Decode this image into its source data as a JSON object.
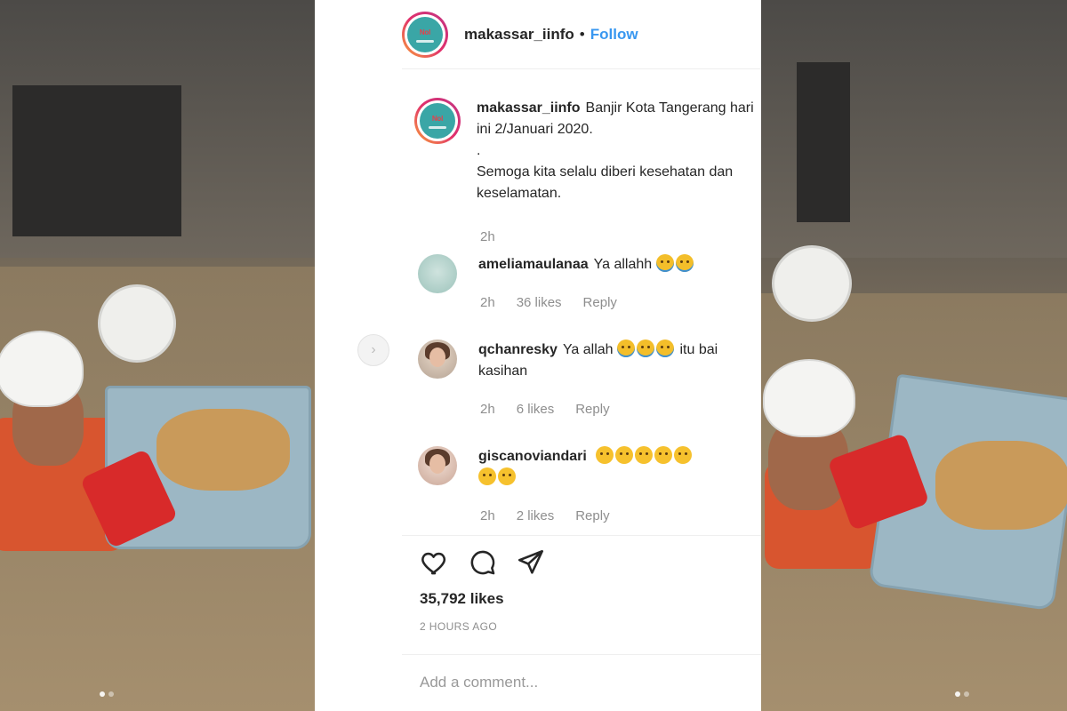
{
  "post": {
    "username": "makassar_iinfo",
    "follow_label": "Follow",
    "separator": "•",
    "logo_text": "Nol"
  },
  "caption": {
    "username": "makassar_iinfo",
    "line1": "Banjir Kota Tangerang hari ini 2/Januari 2020.",
    "line2": ".",
    "line3": "Semoga kita selalu diberi kesehatan dan keselamatan.",
    "time": "2h"
  },
  "comments": [
    {
      "username": "ameliamaulanaa",
      "text": "Ya allahh",
      "emoji_count": 2,
      "emoji": "crying-face-icon",
      "time": "2h",
      "likes": "36 likes",
      "reply": "Reply"
    },
    {
      "username": "qchanresky",
      "text": "Ya allah",
      "after_text": "itu bai kasihan",
      "emoji_count": 3,
      "emoji": "crying-face-icon",
      "time": "2h",
      "likes": "6 likes",
      "reply": "Reply"
    },
    {
      "username": "giscanoviandari",
      "text": "",
      "emoji_count": 7,
      "emoji": "sad-face-icon",
      "time": "2h",
      "likes": "2 likes",
      "reply": "Reply"
    }
  ],
  "footer": {
    "likes": "35,792 likes",
    "time": "2 HOURS AGO",
    "comment_placeholder": "Add a comment..."
  },
  "colors": {
    "link": "#3897f0",
    "text": "#262626",
    "muted": "#8e8e8e"
  }
}
